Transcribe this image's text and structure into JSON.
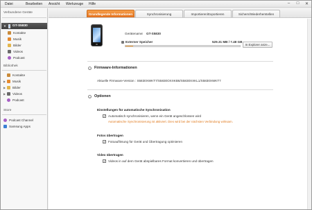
{
  "menu": [
    "Datei",
    "Bearbeiten",
    "Ansicht",
    "Werkzeuge",
    "Hilfe"
  ],
  "window_controls": [
    "–",
    "□",
    "✕"
  ],
  "sidebar": {
    "connected_header": "Verbundene Geräte",
    "device_name": "GT-S5830",
    "device_items": [
      {
        "label": "Kontakte",
        "icon": "contacts-icon"
      },
      {
        "label": "Musik",
        "icon": "music-icon"
      },
      {
        "label": "Bilder",
        "icon": "pictures-icon"
      },
      {
        "label": "Videos",
        "icon": "videos-icon"
      },
      {
        "label": "Podcast",
        "icon": "podcast-icon"
      }
    ],
    "library_header": "Bibliothek",
    "library_items": [
      {
        "label": "Kontakte",
        "icon": "contacts-icon"
      },
      {
        "label": "Musik",
        "icon": "music-icon"
      },
      {
        "label": "Bilder",
        "icon": "pictures-icon"
      },
      {
        "label": "Videos",
        "icon": "videos-icon"
      },
      {
        "label": "Podcast",
        "icon": "podcast-icon"
      }
    ],
    "store_header": "Store",
    "store_items": [
      {
        "label": "Podcast Channel",
        "icon": "podcast-channel-icon"
      },
      {
        "label": "Samsung Apps",
        "icon": "samsung-apps-icon"
      }
    ]
  },
  "tabs": [
    {
      "label": "Grundlegende Informationen",
      "active": true
    },
    {
      "label": "Synchronisierung",
      "active": false
    },
    {
      "label": "Importieren/Exportieren",
      "active": false
    },
    {
      "label": "Sichern/Wiederherstellen",
      "active": false
    }
  ],
  "device": {
    "name_label": "Gerätename",
    "name_sep": ":",
    "name_value": "GT-S5830",
    "storage_label": "Externer Speicher",
    "storage_value": "529.31 MB / 7.48 GB",
    "storage_fraction": 0.0691,
    "explorer_button": "In Explorer anze..."
  },
  "firmware": {
    "title": "Firmware-Informationen",
    "version_text": "Aktuelle Firmware-Version : S5830XWKT7/S5830OXXKB6/S5830XXKL1/S5830XWKT7"
  },
  "options": {
    "title": "Optionen",
    "autosync_title": "Einstellungen für automatische Synchronisation",
    "autosync_check": "Automatisch synchronisieren, wenn ein Gerät angeschlossen wird",
    "autosync_warning": "Automatische Synchronisierung ist aktiviert. Dies wird bei der nächsten Verbindung wirksam.",
    "photo_title": "Fotos übertragen",
    "photo_check": "Fotoauflösung für Gerät und Übertragung optimieren",
    "video_title": "Video übertragen",
    "video_check": "Videos in auf dem Gerät abspielbares Format konvertieren und übertragen",
    "check_mark": "✓"
  },
  "colors": {
    "accent": "#e8781f",
    "warning": "#e07a1e",
    "device_row": "#4a4a4a"
  }
}
